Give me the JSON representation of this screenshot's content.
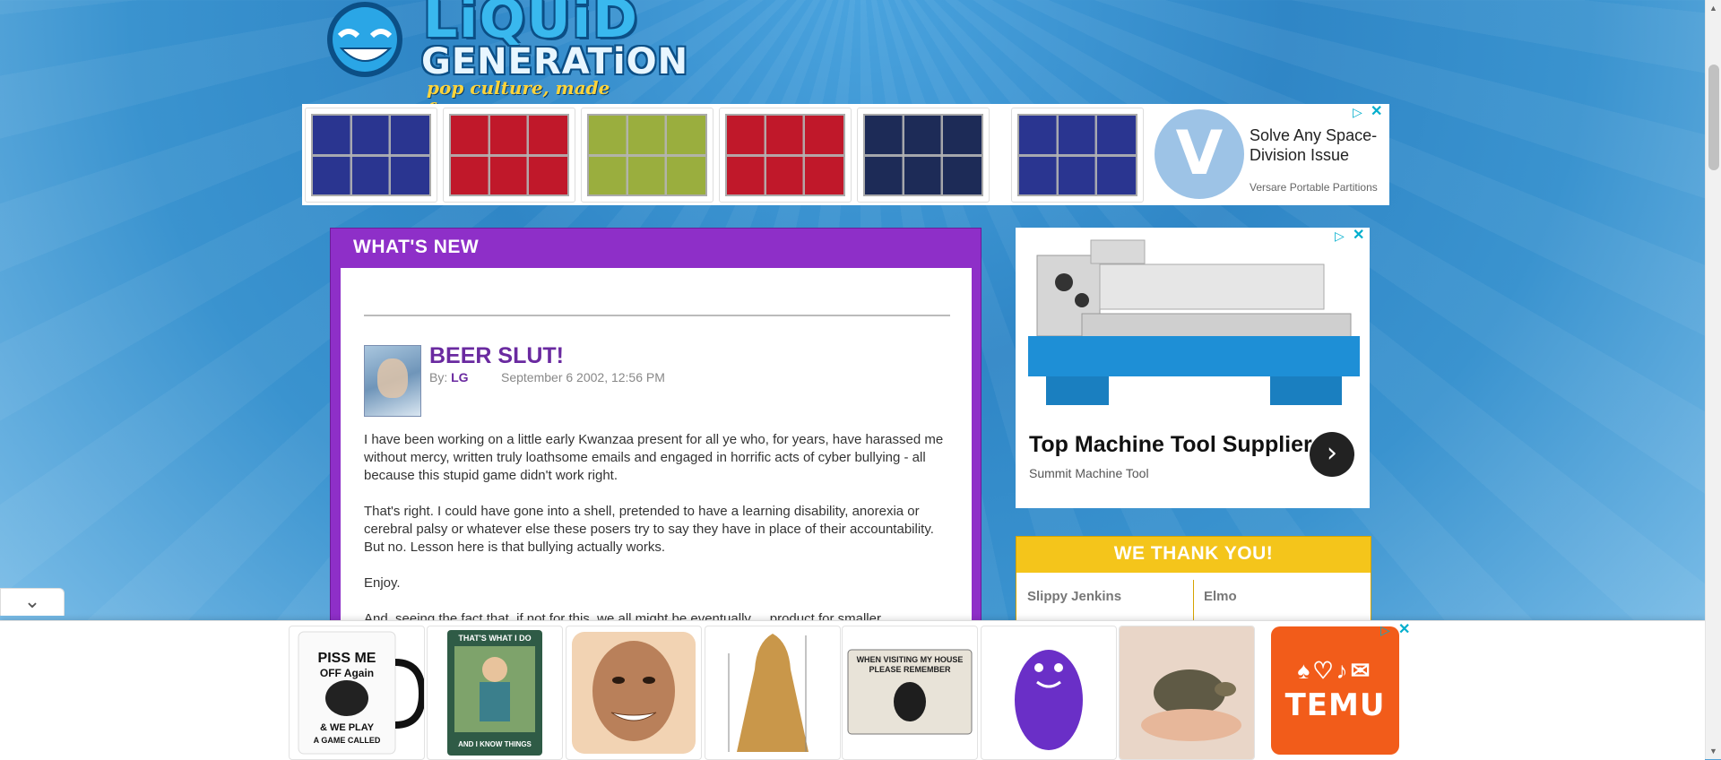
{
  "logo": {
    "word1": "LiQUiD",
    "word2": "GENERATiON",
    "tagline": "pop culture, made funny."
  },
  "top_ad": {
    "panel_colors": [
      "#2a3590",
      "#c0182a",
      "#9aae3e",
      "#c0182a",
      "#1d2b57",
      "#2a3590"
    ],
    "logo_letter": "V",
    "headline": "Solve Any Space-Division Issue",
    "brand": "Versare Portable Partitions"
  },
  "whats_new": {
    "title": "WHAT'S NEW",
    "post": {
      "title": "BEER SLUT!",
      "by_label": "By:",
      "author": "LG",
      "date": "September 6 2002, 12:56 PM",
      "paragraphs": [
        "I have been working on a little early Kwanzaa present for all ye who, for years, have harassed me without mercy, written truly loathsome emails and engaged in horrific acts of cyber bullying - all because this stupid game didn't work right.",
        "That's right. I could have gone into a shell, pretended to have a learning disability, anorexia or cerebral palsy or whatever else these posers try to say they have in place of their accountability. But no. Lesson here is that bullying actually works.",
        "Enjoy.",
        "And, seeing the fact that, if not for this, we all might be eventually ... product for smaller..."
      ]
    }
  },
  "side_ad": {
    "headline": "Top Machine Tool Supplier",
    "brand": "Summit Machine Tool",
    "arrow_icon": "chevron-right"
  },
  "thanks": {
    "title": "WE THANK YOU!",
    "names": [
      "Slippy Jenkins",
      "Elmo"
    ]
  },
  "bottom_ad": {
    "products": [
      {
        "name": "PISS ME OFF Again & WE PLAY A GAME CALLED DUCT. DUCT. TAPE"
      },
      {
        "name": "THAT'S WHAT I DO I GARDEN I DRINK AND I KNOW THINGS"
      },
      {
        "name": "face pillow"
      },
      {
        "name": "gold cloak"
      },
      {
        "name": "WHEN VISITING MY HOUSE PLEASE REMEMBER"
      },
      {
        "name": "purple plush"
      },
      {
        "name": "tortoise"
      }
    ],
    "temu_label": "TEMU"
  }
}
